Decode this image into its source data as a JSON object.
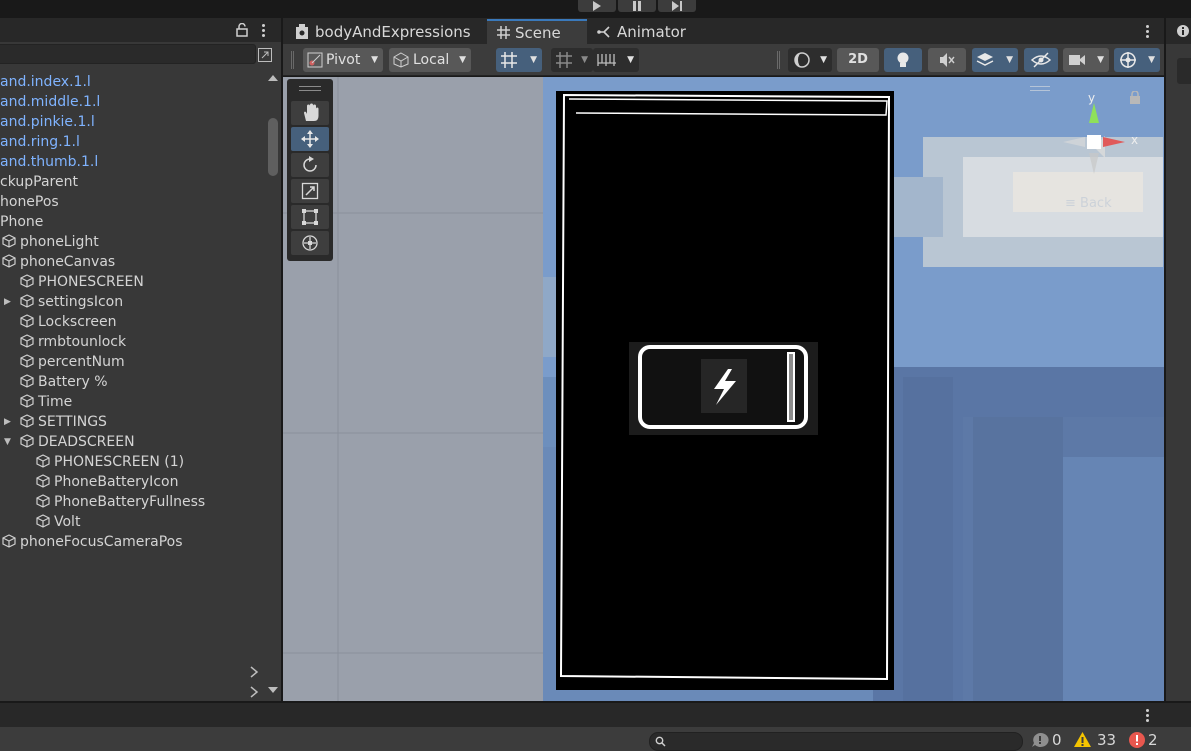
{
  "playbar": {
    "buttons": [
      "play-icon",
      "pause-icon",
      "step-icon"
    ]
  },
  "hierarchy": {
    "items": [
      {
        "label": "and.index.1.l",
        "blue": true,
        "indent": 0,
        "icon": false
      },
      {
        "label": "and.middle.1.l",
        "blue": true,
        "indent": 0,
        "icon": false
      },
      {
        "label": "and.pinkie.1.l",
        "blue": true,
        "indent": 0,
        "icon": false
      },
      {
        "label": "and.ring.1.l",
        "blue": true,
        "indent": 0,
        "icon": false
      },
      {
        "label": "and.thumb.1.l",
        "blue": true,
        "indent": 0,
        "icon": false
      },
      {
        "label": "ckupParent",
        "blue": false,
        "indent": 0,
        "icon": false
      },
      {
        "label": "honePos",
        "blue": false,
        "indent": 0,
        "icon": false
      },
      {
        "label": "Phone",
        "blue": false,
        "indent": 0,
        "icon": false
      },
      {
        "label": "phoneLight",
        "blue": false,
        "indent": 1,
        "icon": true
      },
      {
        "label": "phoneCanvas",
        "blue": false,
        "indent": 1,
        "icon": true
      },
      {
        "label": "PHONESCREEN",
        "blue": false,
        "indent": 2,
        "icon": true
      },
      {
        "label": "settingsIcon",
        "blue": false,
        "indent": 2,
        "icon": true,
        "arrow": "right"
      },
      {
        "label": "Lockscreen",
        "blue": false,
        "indent": 2,
        "icon": true
      },
      {
        "label": "rmbtounlock",
        "blue": false,
        "indent": 2,
        "icon": true
      },
      {
        "label": "percentNum",
        "blue": false,
        "indent": 2,
        "icon": true
      },
      {
        "label": "Battery %",
        "blue": false,
        "indent": 2,
        "icon": true
      },
      {
        "label": "Time",
        "blue": false,
        "indent": 2,
        "icon": true
      },
      {
        "label": "SETTINGS",
        "blue": false,
        "indent": 2,
        "icon": true,
        "arrow": "right"
      },
      {
        "label": "DEADSCREEN",
        "blue": false,
        "indent": 2,
        "icon": true,
        "arrow": "down"
      },
      {
        "label": "PHONESCREEN (1)",
        "blue": false,
        "indent": 3,
        "icon": true
      },
      {
        "label": "PhoneBatteryIcon",
        "blue": false,
        "indent": 3,
        "icon": true
      },
      {
        "label": "PhoneBatteryFullness",
        "blue": false,
        "indent": 3,
        "icon": true
      },
      {
        "label": "Volt",
        "blue": false,
        "indent": 3,
        "icon": true
      },
      {
        "label": "phoneFocusCameraPos",
        "blue": false,
        "indent": 1,
        "icon": true
      }
    ]
  },
  "tabs": [
    {
      "label": "bodyAndExpressions",
      "icon": "scene-file-icon"
    },
    {
      "label": "Scene",
      "icon": "grid-hash-icon"
    },
    {
      "label": "Animator",
      "icon": "animator-icon"
    }
  ],
  "toolbar": {
    "pivot_label": "Pivot",
    "local_label": "Local",
    "mode_2d_label": "2D"
  },
  "gizmo": {
    "y_label": "y",
    "x_label": "x",
    "view_label": "Back"
  },
  "console": {
    "messages": "0",
    "warnings": "33",
    "errors": "2"
  },
  "colors": {
    "accent": "#3a79bb",
    "link_blue": "#7fb3ff",
    "warning": "#f5c400",
    "error": "#e8574e"
  }
}
